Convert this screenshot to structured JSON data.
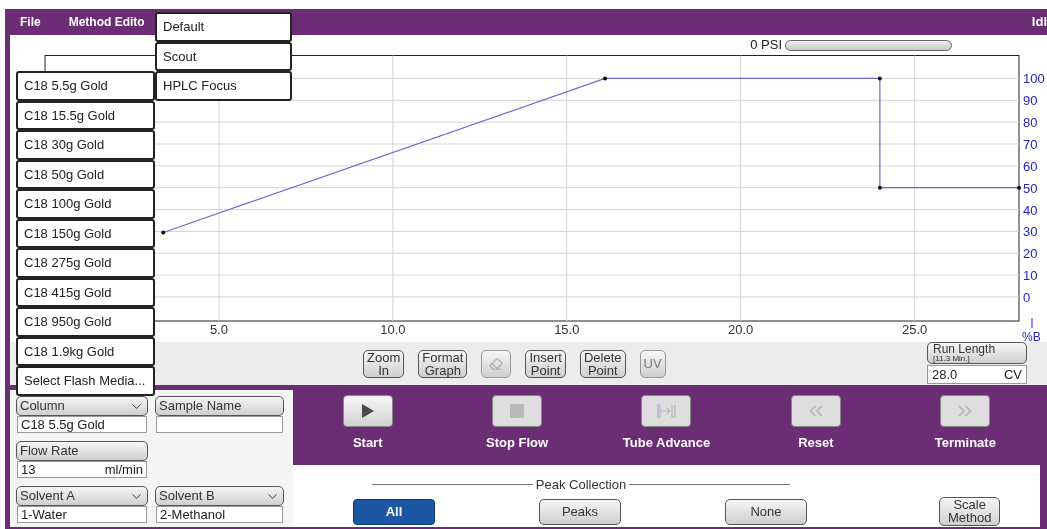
{
  "menu_bar": {
    "items": [
      "File",
      "Method Edito"
    ],
    "status": "Idl"
  },
  "method_menu": {
    "items": [
      "Default",
      "Scout",
      "HPLC Focus"
    ]
  },
  "media_menu": {
    "items": [
      "C18 5.5g Gold",
      "C18 15.5g Gold",
      "C18 30g Gold",
      "C18 50g Gold",
      "C18 100g Gold",
      "C18 150g Gold",
      "C18 275g Gold",
      "C18 415g Gold",
      "C18 950g Gold",
      "C18 1.9kg Gold",
      "Select Flash Media..."
    ]
  },
  "pressure": {
    "reading": "0 PSI",
    "level": 0
  },
  "gradient_graph": {
    "chart_data": {
      "type": "line",
      "grid": true,
      "ylabel": "%B",
      "x": [
        3.4,
        16.1,
        24,
        24,
        28
      ],
      "values": [
        29.5,
        100,
        100,
        50,
        50
      ],
      "xlim": [
        0,
        28
      ],
      "ylim": [
        -11,
        110.5
      ],
      "xticks": [
        {
          "value": 5,
          "label": "5.0"
        },
        {
          "value": 10,
          "label": "10.0"
        },
        {
          "value": 15,
          "label": "15.0"
        },
        {
          "value": 20,
          "label": "20.0"
        },
        {
          "value": 25,
          "label": "25.0"
        }
      ],
      "yticks": [
        0,
        10,
        20,
        30,
        40,
        50,
        60,
        70,
        80,
        90,
        100
      ]
    }
  },
  "graph_tools": [
    {
      "kind": "text",
      "label": "Zoom In",
      "disabled": false
    },
    {
      "kind": "text",
      "label": "Format Graph",
      "disabled": false
    },
    {
      "kind": "eraser",
      "disabled": true
    },
    {
      "kind": "text",
      "label": "Insert Point",
      "disabled": false
    },
    {
      "kind": "text",
      "label": "Delete Point",
      "disabled": false
    },
    {
      "kind": "text",
      "label": "UV",
      "disabled": true
    }
  ],
  "run_length": {
    "label": "Run Length",
    "note": "[11.3 Min.]",
    "value": "28.0",
    "unit": "CV"
  },
  "settings": [
    {
      "kind": "dropdown",
      "label": "Column",
      "value": "C18 5.5g Gold"
    },
    {
      "kind": "button",
      "label": "Sample Name"
    },
    {
      "kind": "button",
      "label": "Flow Rate",
      "value": "13",
      "unit": "ml/min"
    },
    {
      "kind": "dropdown",
      "label": "Solvent A",
      "value": "1-Water"
    },
    {
      "kind": "dropdown",
      "label": "Solvent B",
      "value": "2-Methanol"
    }
  ],
  "run_controls": [
    {
      "kind": "play",
      "label": "Start",
      "disabled": false
    },
    {
      "kind": "stop",
      "label": "Stop Flow",
      "disabled": true
    },
    {
      "kind": "tube",
      "label": "Tube Advance",
      "disabled": true
    },
    {
      "kind": "rewind",
      "label": "Reset",
      "disabled": true
    },
    {
      "kind": "forward",
      "label": "Terminate",
      "disabled": true
    }
  ],
  "peak_collection": {
    "title": "Peak Collection",
    "options": [
      {
        "label": "All",
        "selected": true
      },
      {
        "label": "Peaks",
        "selected": false
      },
      {
        "label": "None",
        "selected": false
      }
    ]
  },
  "scale_button": "Scale Method"
}
